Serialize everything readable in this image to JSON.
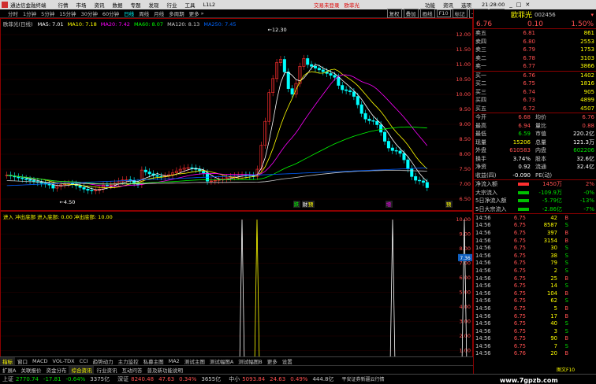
{
  "titlebar": {
    "app": "通达信金融终端",
    "menus": [
      "行情",
      "市场",
      "资讯",
      "数据",
      "专题",
      "发现",
      "行业",
      "工具",
      "L1L2"
    ],
    "banner": "交易未登录",
    "stock_name": "欧菲光",
    "right_items": [
      "功能",
      "资讯",
      "选项"
    ],
    "time": "21:28:00"
  },
  "toolbar": {
    "periods": [
      "分时",
      "1分钟",
      "5分钟",
      "15分钟",
      "30分钟",
      "60分钟",
      "日线",
      "周线",
      "月线",
      "多周期",
      "更多"
    ],
    "active_period": "日线",
    "right_buttons": [
      "复权",
      "叠加",
      "画线",
      "F10",
      "标记",
      "+自选",
      "返回"
    ]
  },
  "main_chart": {
    "header": "欧菲光(日线)",
    "ma": [
      {
        "label": "MA5: 7.01",
        "color": "#ffffff"
      },
      {
        "label": "MA10: 7.18",
        "color": "#ffff00"
      },
      {
        "label": "MA20: 7.42",
        "color": "#ff00ff"
      },
      {
        "label": "MA60: 8.07",
        "color": "#00ff00"
      },
      {
        "label": "MA120: 8.13",
        "color": "#c8c8c8"
      },
      {
        "label": "MA250: 7.45",
        "color": "#0060ff"
      }
    ],
    "y_ticks": [
      "12.00",
      "11.50",
      "11.00",
      "10.50",
      "10.00",
      "9.50",
      "9.00",
      "8.50",
      "8.00",
      "7.50",
      "7.00",
      "6.50"
    ],
    "high_label": "12.30",
    "low_label": "4.50",
    "markers": [
      {
        "text": "跌",
        "color": "#00ff00"
      },
      {
        "text": "财",
        "color": "#ffffff"
      },
      {
        "text": "预",
        "color": "#ffff00"
      },
      {
        "text": "增",
        "color": "#ff00ff"
      },
      {
        "text": "预",
        "color": "#ffff00"
      }
    ]
  },
  "sub_chart": {
    "header": "进入 冲出底部  进入底部: 0.00  冲出底部: 10.00",
    "y_ticks": [
      "10.00",
      "9.00",
      "8.00",
      "7.00",
      "6.00",
      "5.00",
      "4.00",
      "3.00",
      "2.00",
      "1.00"
    ],
    "cursor_value": "7.36"
  },
  "time_axis": {
    "labels": [
      "2023年",
      "4",
      "5",
      "6",
      "7",
      "8",
      "9",
      "10",
      "11",
      "12",
      "2"
    ],
    "cursor_date": "2023/07/13/四"
  },
  "quote": {
    "code": "002456",
    "name": "欧菲光",
    "price": "6.76",
    "change": "0.10",
    "pct": "1.50%",
    "asks": [
      {
        "label": "卖五",
        "price": "6.81",
        "vol": "861"
      },
      {
        "label": "卖四",
        "price": "6.80",
        "vol": "2553"
      },
      {
        "label": "卖三",
        "price": "6.79",
        "vol": "1753"
      },
      {
        "label": "卖二",
        "price": "6.78",
        "vol": "3103"
      },
      {
        "label": "卖一",
        "price": "6.77",
        "vol": "3866"
      }
    ],
    "bids": [
      {
        "label": "买一",
        "price": "6.76",
        "vol": "1402"
      },
      {
        "label": "买二",
        "price": "6.75",
        "vol": "1816"
      },
      {
        "label": "买三",
        "price": "6.74",
        "vol": "905"
      },
      {
        "label": "买四",
        "price": "6.73",
        "vol": "4899"
      },
      {
        "label": "买五",
        "price": "6.72",
        "vol": "4507"
      }
    ],
    "stats": [
      {
        "l1": "今开",
        "v1": "6.68",
        "l2": "均价",
        "v2": "6.76"
      },
      {
        "l1": "最高",
        "v1": "6.94",
        "l2": "量比",
        "v2": "0.88"
      },
      {
        "l1": "最低",
        "v1": "6.59",
        "l2": "市值",
        "v2": "220.2亿"
      },
      {
        "l1": "现量",
        "v1": "15206",
        "l2": "总量",
        "v2": "121.3万"
      },
      {
        "l1": "外盘",
        "v1": "610583",
        "l2": "内盘",
        "v2": "602206"
      },
      {
        "l1": "换手",
        "v1": "3.74%",
        "l2": "股本",
        "v2": "32.6亿"
      },
      {
        "l1": "净资",
        "v1": "0.92",
        "l2": "流通",
        "v2": "32.4亿"
      },
      {
        "l1": "收益(四)",
        "v1": "-0.090",
        "l2": "PE(动)",
        "v2": ""
      }
    ],
    "flows": [
      {
        "label": "净流入额",
        "val": "1450万",
        "pct": "2%"
      },
      {
        "label": "大宗流入",
        "val": "-109.9万",
        "pct": "-0%"
      },
      {
        "label": "5日净流入额",
        "val": "-5.79亿",
        "pct": "-13%"
      },
      {
        "label": "5日大宗流入",
        "val": "-2.86亿",
        "pct": "-7%"
      }
    ],
    "ticks": [
      [
        "14:56",
        "6.75",
        "42",
        "B"
      ],
      [
        "14:56",
        "6.75",
        "8587",
        "S"
      ],
      [
        "14:56",
        "6.75",
        "397",
        "B"
      ],
      [
        "14:56",
        "6.75",
        "3154",
        "B"
      ],
      [
        "14:56",
        "6.75",
        "30",
        "S"
      ],
      [
        "14:56",
        "6.75",
        "38",
        "S"
      ],
      [
        "14:56",
        "6.75",
        "79",
        "S"
      ],
      [
        "14:56",
        "6.75",
        "2",
        "S"
      ],
      [
        "14:56",
        "6.75",
        "25",
        "B"
      ],
      [
        "14:56",
        "6.75",
        "14",
        "S"
      ],
      [
        "14:56",
        "6.75",
        "104",
        "B"
      ],
      [
        "14:56",
        "6.75",
        "62",
        "S"
      ],
      [
        "14:56",
        "6.75",
        "5",
        "B"
      ],
      [
        "14:56",
        "6.75",
        "17",
        "B"
      ],
      [
        "14:56",
        "6.75",
        "40",
        "S"
      ],
      [
        "14:56",
        "6.75",
        "3",
        "S"
      ],
      [
        "14:56",
        "6.75",
        "90",
        "B"
      ],
      [
        "14:56",
        "6.75",
        "7",
        "S"
      ],
      [
        "14:56",
        "6.76",
        "20",
        "B"
      ]
    ]
  },
  "bottom_tabs": [
    "指标",
    "窗口",
    "MACD",
    "VOL-TDX",
    "CCI",
    "趋势动力",
    "主力监控",
    "私募主图",
    "MA2",
    "测试主图",
    "测试幅图A",
    "测试幅图B",
    "更多",
    "设置"
  ],
  "bottom_tabs2": [
    "扩展A",
    "关联报价",
    "资金分布",
    "综合资讯",
    "行业资讯",
    "互动问答",
    "普及新功能说明"
  ],
  "statusbar": {
    "items": [
      {
        "name": "上证",
        "val": "2770.74",
        "chg": "-17.81",
        "pct": "-0.64%",
        "amt": "3375亿"
      },
      {
        "name": "深证",
        "val": "8240.48",
        "chg": "47.63",
        "pct": "0.34%",
        "amt": "3655亿"
      },
      {
        "name": "中小",
        "val": "5093.84",
        "chg": "24.63",
        "pct": "0.49%",
        "amt": "444.8亿"
      }
    ],
    "broker": "平安证券新疆云行情",
    "right": "图文F10"
  },
  "watermark": "www.7gpzb.com"
}
